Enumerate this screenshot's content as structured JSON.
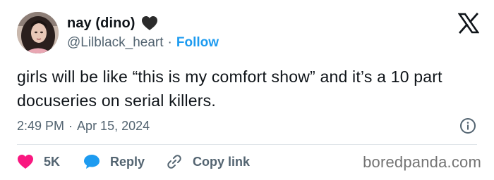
{
  "author": {
    "display_name": "nay (dino)",
    "handle": "@Lilblack_heart",
    "separator": "·",
    "follow_label": "Follow",
    "badge_icon": "black-heart-icon",
    "avatar_icon": "profile-avatar"
  },
  "brand": {
    "logo_icon": "x-logo-icon"
  },
  "tweet": {
    "text": "girls will be like “this is my comfort show” and it’s a 10 part docuseries on serial killers."
  },
  "meta": {
    "time": "2:49 PM",
    "separator": "·",
    "date": "Apr 15, 2024",
    "info_icon": "info-icon"
  },
  "actions": {
    "likes_count": "5K",
    "reply_label": "Reply",
    "copy_link_label": "Copy link"
  },
  "watermark": {
    "text": "boredpanda.com"
  },
  "colors": {
    "accent": "#1d9bf0",
    "like": "#f91880",
    "text_primary": "#0f1419",
    "text_secondary": "#536471"
  }
}
